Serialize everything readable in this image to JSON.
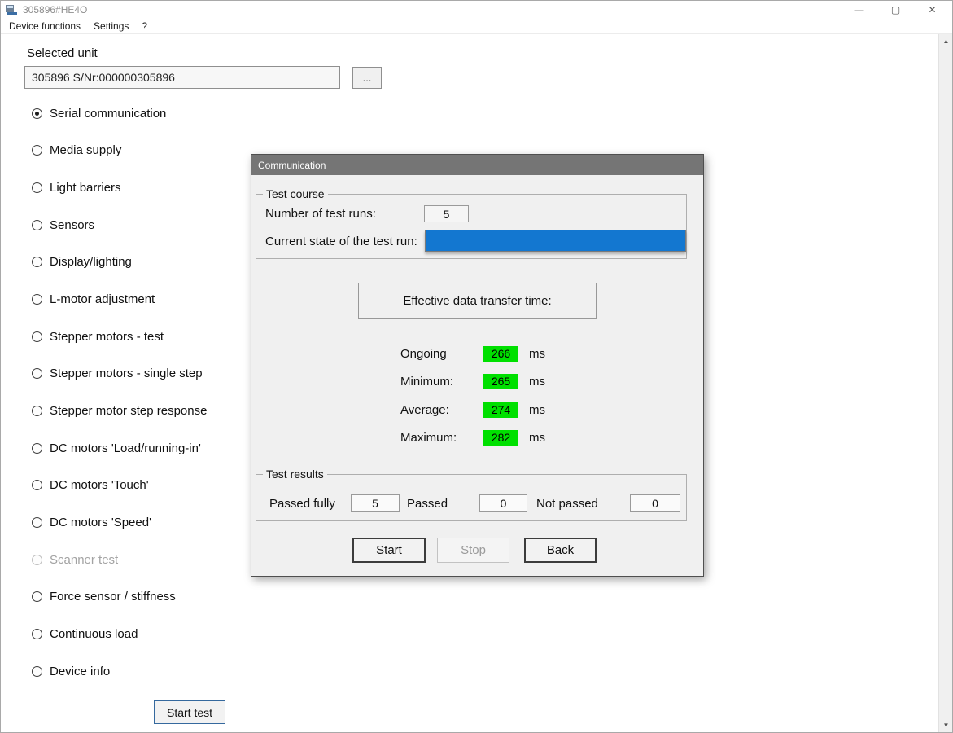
{
  "window": {
    "title": "305896#HE4O",
    "minimize": "—",
    "maximize": "▢",
    "close": "✕"
  },
  "menu": {
    "items": [
      {
        "label": "Device functions"
      },
      {
        "label": "Settings"
      },
      {
        "label": "?"
      }
    ]
  },
  "main": {
    "selected_unit_label": "Selected unit",
    "unit_value": "305896 S/Nr:000000305896",
    "browse_button_label": "...",
    "start_test_button_label": "Start test",
    "radio_options": [
      {
        "label": "Serial communication",
        "selected": true,
        "disabled": false
      },
      {
        "label": "Media supply",
        "selected": false,
        "disabled": false
      },
      {
        "label": "Light barriers",
        "selected": false,
        "disabled": false
      },
      {
        "label": "Sensors",
        "selected": false,
        "disabled": false
      },
      {
        "label": "Display/lighting",
        "selected": false,
        "disabled": false
      },
      {
        "label": "L-motor adjustment",
        "selected": false,
        "disabled": false
      },
      {
        "label": "Stepper motors - test",
        "selected": false,
        "disabled": false
      },
      {
        "label": "Stepper motors - single step",
        "selected": false,
        "disabled": false
      },
      {
        "label": "Stepper motor step response",
        "selected": false,
        "disabled": false
      },
      {
        "label": "DC motors 'Load/running-in'",
        "selected": false,
        "disabled": false
      },
      {
        "label": "DC motors 'Touch'",
        "selected": false,
        "disabled": false
      },
      {
        "label": "DC motors 'Speed'",
        "selected": false,
        "disabled": false
      },
      {
        "label": "Scanner test",
        "selected": false,
        "disabled": true
      },
      {
        "label": "Force sensor / stiffness",
        "selected": false,
        "disabled": false
      },
      {
        "label": "Continuous load",
        "selected": false,
        "disabled": false
      },
      {
        "label": "Device info",
        "selected": false,
        "disabled": false
      }
    ]
  },
  "dialog": {
    "title": "Communication",
    "test_course": {
      "legend": "Test course",
      "runs_label": "Number of test runs:",
      "runs_value": "5",
      "state_label": "Current state of the test run:",
      "progress_percent": 100
    },
    "transfer_time_title": "Effective data transfer time:",
    "measurements": [
      {
        "label": "Ongoing",
        "value": "266",
        "unit": "ms"
      },
      {
        "label": "Minimum:",
        "value": "265",
        "unit": "ms"
      },
      {
        "label": "Average:",
        "value": "274",
        "unit": "ms"
      },
      {
        "label": "Maximum:",
        "value": "282",
        "unit": "ms"
      }
    ],
    "test_results": {
      "legend": "Test results",
      "passed_fully_label": "Passed fully",
      "passed_fully_value": "5",
      "passed_label": "Passed",
      "passed_value": "0",
      "not_passed_label": "Not passed",
      "not_passed_value": "0"
    },
    "buttons": [
      {
        "label": "Start",
        "disabled": false
      },
      {
        "label": "Stop",
        "disabled": true
      },
      {
        "label": "Back",
        "disabled": false
      }
    ]
  },
  "colors": {
    "progress_fill": "#1377d0",
    "value_highlight": "#00e000",
    "dialog_titlebar": "#757575"
  }
}
